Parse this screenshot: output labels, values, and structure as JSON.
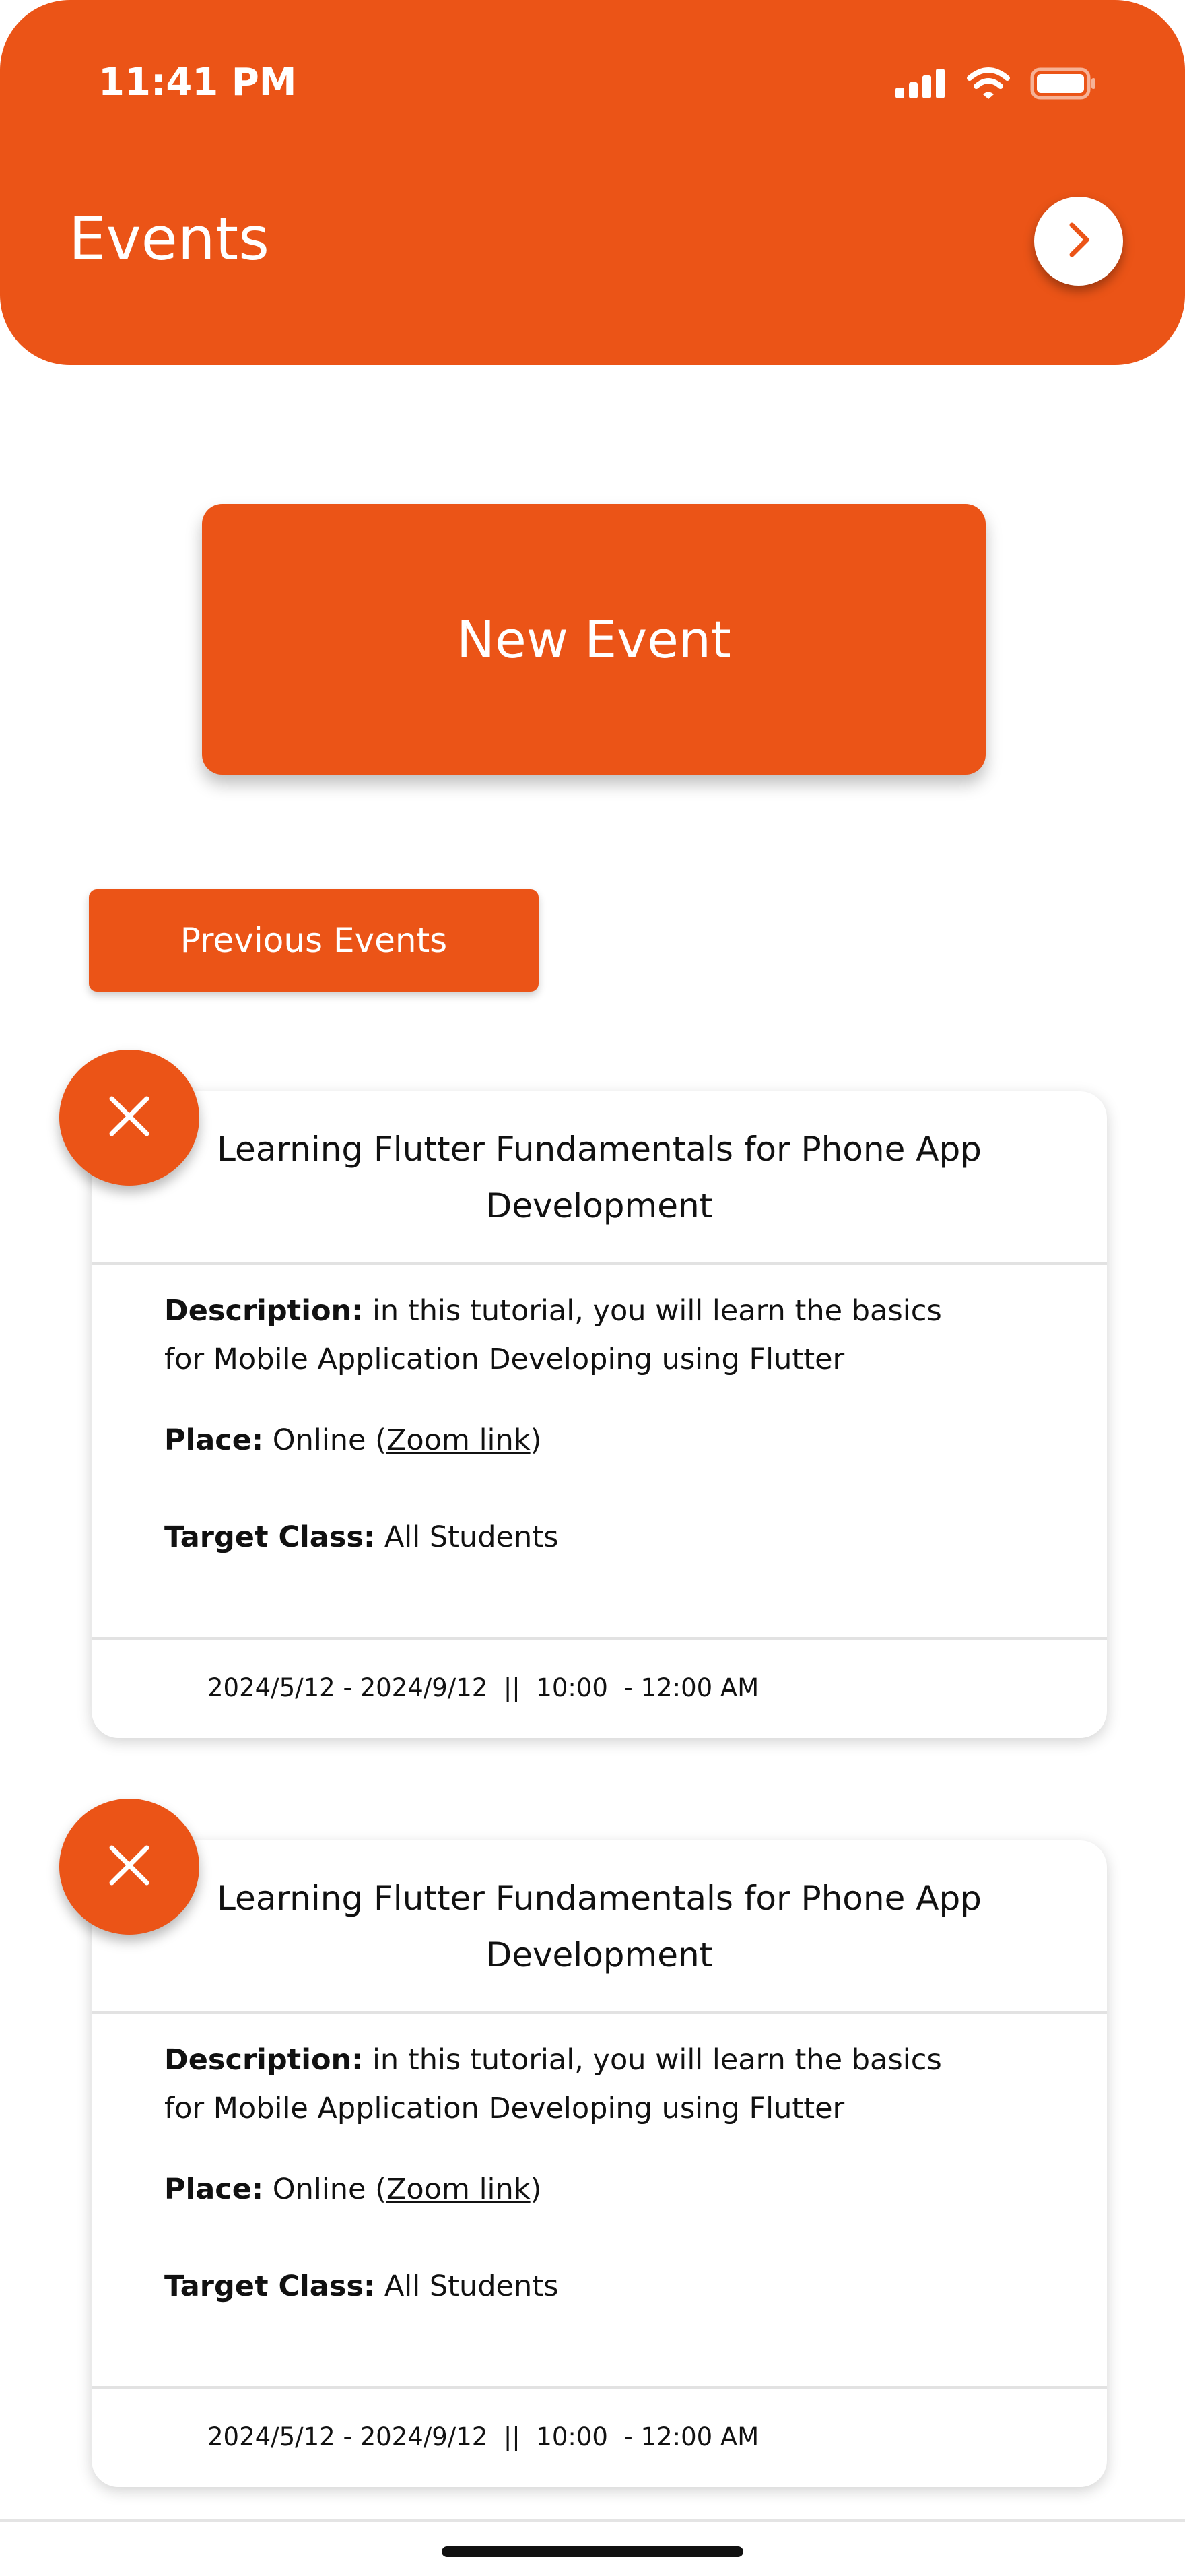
{
  "status_bar": {
    "time": "11:41 PM",
    "icons": [
      "signal-icon",
      "wifi-icon",
      "battery-icon"
    ]
  },
  "header": {
    "title": "Events",
    "action_icon": "chevron-right-icon"
  },
  "new_event": {
    "label": "New Event"
  },
  "previous_events": {
    "label": "Previous Events"
  },
  "events": [
    {
      "title": "Learning Flutter Fundamentals for Phone App Development",
      "description_label": "Description:",
      "description": "in this tutorial, you will learn the basics for Mobile Application Developing using Flutter",
      "place_label": "Place:",
      "place_prefix": "Online (",
      "place_link": "Zoom  link",
      "place_suffix": ")",
      "target_label": "Target Class:",
      "target": "All Students",
      "dates": "2024/5/12 - 2024/9/12  ||  10:00  - 12:00 AM",
      "delete_icon": "close-icon"
    },
    {
      "title": "Learning Flutter Fundamentals for Phone App Development",
      "description_label": "Description:",
      "description": "in this tutorial, you will learn the basics for Mobile Application Developing using Flutter",
      "place_label": "Place:",
      "place_prefix": "Online (",
      "place_link": "Zoom  link",
      "place_suffix": ")",
      "target_label": "Target Class:",
      "target": "All Students",
      "dates": "2024/5/12 - 2024/9/12  ||  10:00  - 12:00 AM",
      "delete_icon": "close-icon"
    }
  ],
  "colors": {
    "accent": "#EB5417",
    "background": "#FFFFFF",
    "text": "#111111"
  }
}
